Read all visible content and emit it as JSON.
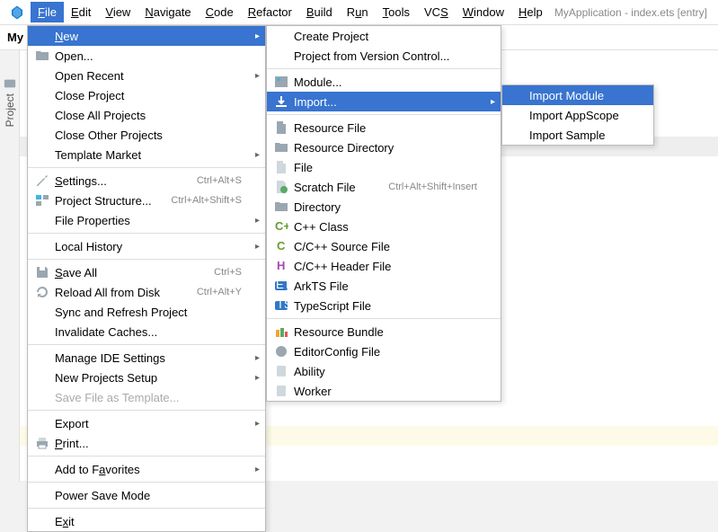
{
  "menubar": {
    "items": [
      {
        "label": "File",
        "mn": "F"
      },
      {
        "label": "Edit",
        "mn": "E"
      },
      {
        "label": "View",
        "mn": "V"
      },
      {
        "label": "Navigate",
        "mn": "N"
      },
      {
        "label": "Code",
        "mn": "C"
      },
      {
        "label": "Refactor",
        "mn": "R"
      },
      {
        "label": "Build",
        "mn": "B"
      },
      {
        "label": "Run",
        "mn": "u"
      },
      {
        "label": "Tools",
        "mn": "T"
      },
      {
        "label": "VCS",
        "mn": "S"
      },
      {
        "label": "Window",
        "mn": "W"
      },
      {
        "label": "Help",
        "mn": "H"
      }
    ]
  },
  "title": "MyApplication - index.ets [entry]",
  "toolbar_prefix": "My",
  "sidebar": {
    "project": "Project"
  },
  "file_menu": {
    "new": "New",
    "open": "Open...",
    "open_recent": "Open Recent",
    "close_project": "Close Project",
    "close_all": "Close All Projects",
    "close_other": "Close Other Projects",
    "template_market": "Template Market",
    "settings": "Settings...",
    "settings_sc": "Ctrl+Alt+S",
    "project_structure": "Project Structure...",
    "project_structure_sc": "Ctrl+Alt+Shift+S",
    "file_properties": "File Properties",
    "local_history": "Local History",
    "save_all": "Save All",
    "save_all_sc": "Ctrl+S",
    "reload": "Reload All from Disk",
    "reload_sc": "Ctrl+Alt+Y",
    "sync_refresh": "Sync and Refresh Project",
    "invalidate": "Invalidate Caches...",
    "manage_ide": "Manage IDE Settings",
    "new_projects_setup": "New Projects Setup",
    "save_template": "Save File as Template...",
    "export": "Export",
    "print": "Print...",
    "favorites": "Add to Favorites",
    "power_save": "Power Save Mode",
    "exit": "Exit"
  },
  "new_menu": {
    "create_project": "Create Project",
    "project_vcs": "Project from Version Control...",
    "module": "Module...",
    "import": "Import...",
    "resource_file": "Resource File",
    "resource_dir": "Resource Directory",
    "file": "File",
    "scratch": "Scratch File",
    "scratch_sc": "Ctrl+Alt+Shift+Insert",
    "directory": "Directory",
    "cpp_class": "C++ Class",
    "cpp_src": "C/C++ Source File",
    "cpp_hdr": "C/C++ Header File",
    "arkts": "ArkTS File",
    "ts": "TypeScript File",
    "resource_bundle": "Resource Bundle",
    "editorconfig": "EditorConfig File",
    "ability": "Ability",
    "worker": "Worker"
  },
  "import_menu": {
    "module": "Import Module",
    "appscope": "Import AppScope",
    "sample": "Import Sample"
  }
}
